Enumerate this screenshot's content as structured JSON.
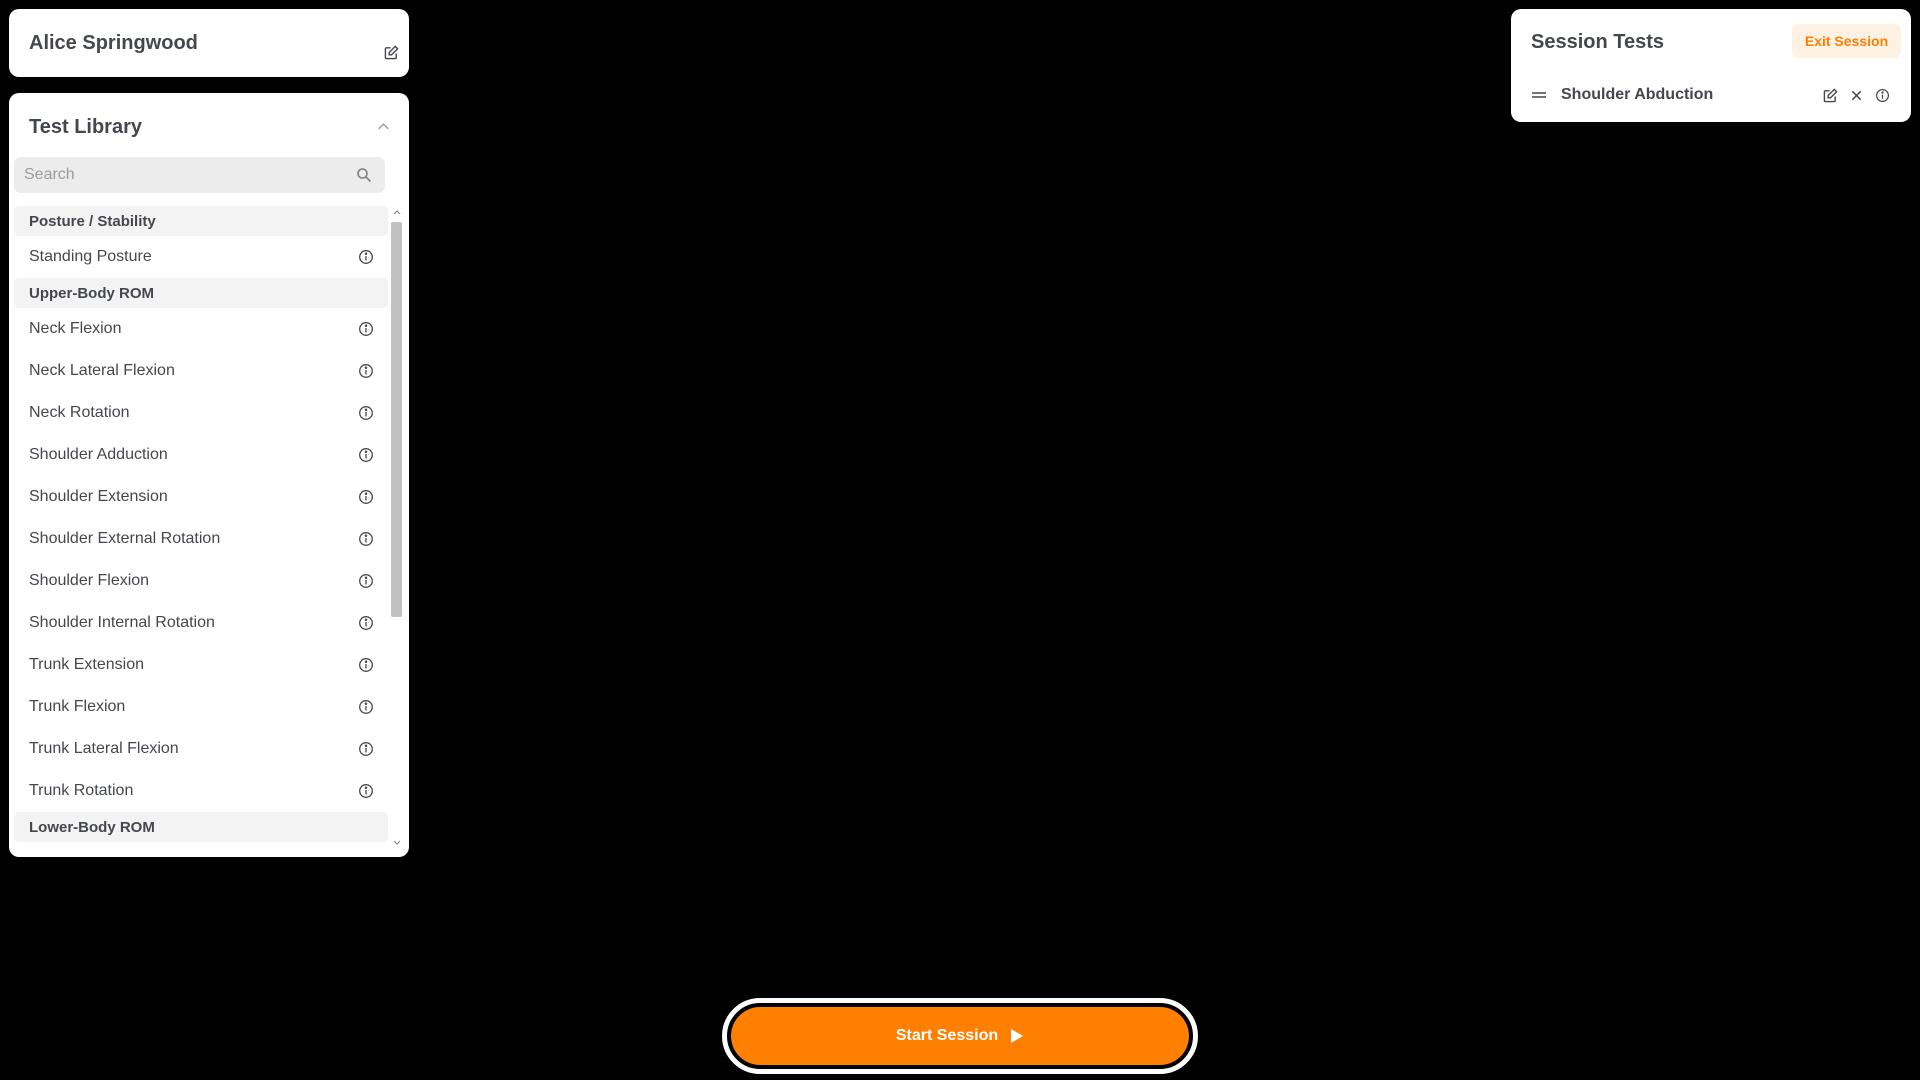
{
  "patient": {
    "name": "Alice Springwood"
  },
  "library": {
    "title": "Test Library",
    "search_placeholder": "Search",
    "categories": [
      {
        "name": "Posture / Stability",
        "tests": [
          "Standing Posture"
        ]
      },
      {
        "name": "Upper-Body ROM",
        "tests": [
          "Neck Flexion",
          "Neck Lateral Flexion",
          "Neck Rotation",
          "Shoulder Adduction",
          "Shoulder Extension",
          "Shoulder External Rotation",
          "Shoulder Flexion",
          "Shoulder Internal Rotation",
          "Trunk Extension",
          "Trunk Flexion",
          "Trunk Lateral Flexion",
          "Trunk Rotation"
        ]
      },
      {
        "name": "Lower-Body ROM",
        "tests": []
      }
    ]
  },
  "session": {
    "title": "Session Tests",
    "exit_label": "Exit Session",
    "items": [
      "Shoulder Abduction"
    ]
  },
  "start_label": "Start Session",
  "colors": {
    "accent": "#ff7f00",
    "accent_soft": "#fff1e3",
    "background": "#000000",
    "text": "#44474c"
  },
  "icons": [
    "edit-icon",
    "chevron-up-icon",
    "search-icon",
    "info-icon",
    "drag-handle-icon",
    "close-icon",
    "play-icon"
  ]
}
